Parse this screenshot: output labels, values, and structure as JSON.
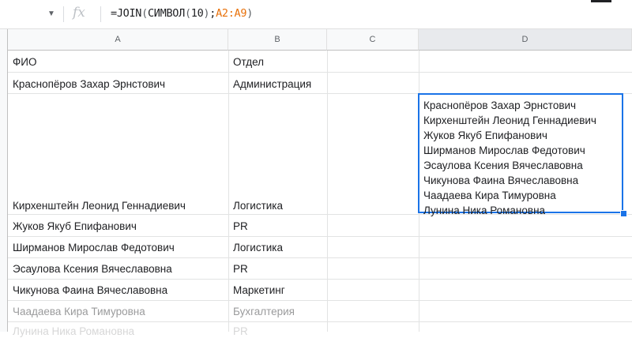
{
  "formula_bar": {
    "fx_label": "fx",
    "formula_prefix": "=JOIN",
    "formula_fn": "СИМВОЛ",
    "formula_arg": "10",
    "formula_range": "A2:A9"
  },
  "columns": [
    "A",
    "B",
    "C",
    "D"
  ],
  "header_row": {
    "name": "ФИО",
    "department": "Отдел"
  },
  "rows": [
    {
      "name": "Краснопёров Захар Эрнстович",
      "department": "Администрация"
    },
    {
      "name": "Кирхенштейн Леонид Геннадиевич",
      "department": "Логистика"
    },
    {
      "name": "Жуков Якуб Епифанович",
      "department": "PR"
    },
    {
      "name": "Ширманов Мирослав Федотович",
      "department": "Логистика"
    },
    {
      "name": "Эсаулова Ксения Вячеславовна",
      "department": "PR"
    },
    {
      "name": "Чикунова Фаина Вячеславовна",
      "department": "Маркетинг"
    },
    {
      "name": "Чаадаева Кира Тимуровна",
      "department": "Бухгалтерия"
    },
    {
      "name": "Лунина Ника Романовна",
      "department": "PR"
    }
  ],
  "joined_result": [
    "Краснопёров Захар Эрнстович",
    "Кирхенштейн Леонид Геннадиевич",
    "Жуков Якуб Епифанович",
    "Ширманов Мирослав Федотович",
    "Эсаулова Ксения Вячеславовна",
    "Чикунова Фаина Вячеславовна",
    "Чаадаева Кира Тимуровна",
    "Лунина Ника Романовна"
  ],
  "colors": {
    "selection": "#1a73e8",
    "range_ref": "#e8710a"
  }
}
